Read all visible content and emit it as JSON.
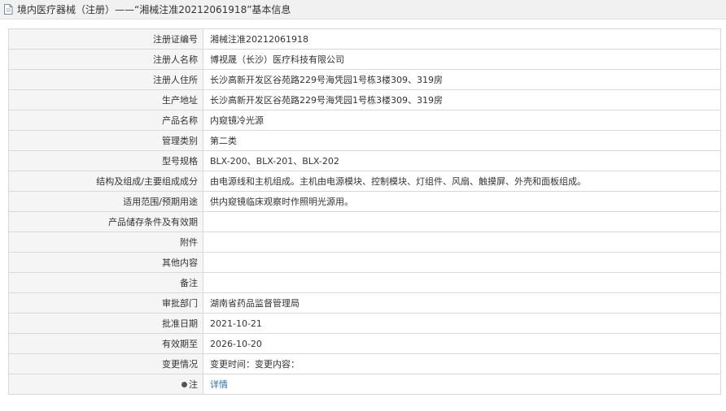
{
  "header": {
    "title": "境内医疗器械（注册）——“湘械注准20212061918”基本信息",
    "icon": "document-icon"
  },
  "rows": [
    {
      "key": "reg-no",
      "label": "注册证编号",
      "value": "湘械注准20212061918"
    },
    {
      "key": "registrant-name",
      "label": "注册人名称",
      "value": "博视晟（长沙）医疗科技有限公司"
    },
    {
      "key": "registrant-address",
      "label": "注册人住所",
      "value": "长沙高新开发区谷苑路229号海凭园1号栋3楼309、319房"
    },
    {
      "key": "production-address",
      "label": "生产地址",
      "value": "长沙高新开发区谷苑路229号海凭园1号栋3楼309、319房"
    },
    {
      "key": "product-name",
      "label": "产品名称",
      "value": "内窥镜冷光源"
    },
    {
      "key": "category",
      "label": "管理类别",
      "value": "第二类"
    },
    {
      "key": "model",
      "label": "型号规格",
      "value": "BLX-200、BLX-201、BLX-202"
    },
    {
      "key": "composition",
      "label": "结构及组成/主要组成成分",
      "value": "由电源线和主机组成。主机由电源模块、控制模块、灯组件、风扇、触摸屏、外壳和面板组成。"
    },
    {
      "key": "scope",
      "label": "适用范围/预期用途",
      "value": "供内窥镜临床观察时作照明光源用。"
    },
    {
      "key": "storage",
      "label": "产品储存条件及有效期",
      "value": ""
    },
    {
      "key": "attachment",
      "label": "附件",
      "value": ""
    },
    {
      "key": "other",
      "label": "其他内容",
      "value": ""
    },
    {
      "key": "remarks",
      "label": "备注",
      "value": ""
    },
    {
      "key": "approval-dept",
      "label": "审批部门",
      "value": "湖南省药品监督管理局"
    },
    {
      "key": "approval-date",
      "label": "批准日期",
      "value": "2021-10-21"
    },
    {
      "key": "valid-until",
      "label": "有效期至",
      "value": "2026-10-20"
    },
    {
      "key": "change",
      "label": "变更情况",
      "value": "变更时间：变更内容："
    }
  ],
  "note": {
    "label": "注",
    "link_text": "详情"
  },
  "colors": {
    "link": "#2e6fbd",
    "label_bg": "#f5f5f5",
    "border": "#d9d9d9"
  }
}
